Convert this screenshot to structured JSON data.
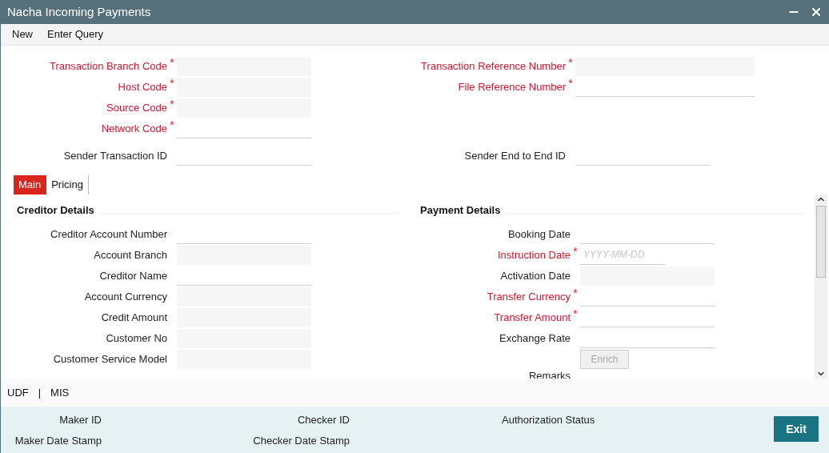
{
  "window": {
    "title": "Nacha Incoming Payments"
  },
  "menu": [
    "New",
    "Enter Query"
  ],
  "required_mark": "*",
  "header": {
    "left": [
      {
        "label": "Transaction Branch Code",
        "required": true,
        "disabled": true
      },
      {
        "label": "Host Code",
        "required": true,
        "disabled": true
      },
      {
        "label": "Source Code",
        "required": true,
        "disabled": true
      },
      {
        "label": "Network Code",
        "required": true,
        "disabled": false
      }
    ],
    "right": [
      {
        "label": "Transaction Reference Number",
        "required": true,
        "disabled": true
      },
      {
        "label": "File Reference Number",
        "required": true,
        "disabled": false
      }
    ],
    "sender_left": {
      "label": "Sender Transaction ID",
      "required": false,
      "disabled": false
    },
    "sender_right": {
      "label": "Sender End to End ID",
      "required": false,
      "disabled": false
    }
  },
  "tabs": [
    {
      "label": "Main",
      "selected": true
    },
    {
      "label": "Pricing",
      "selected": false
    }
  ],
  "creditor": {
    "title": "Creditor Details",
    "fields": [
      {
        "label": "Creditor Account Number",
        "required": false,
        "disabled": false
      },
      {
        "label": "Account Branch",
        "required": false,
        "disabled": true
      },
      {
        "label": "Creditor Name",
        "required": false,
        "disabled": false
      },
      {
        "label": "Account Currency",
        "required": false,
        "disabled": true
      },
      {
        "label": "Credit Amount",
        "required": false,
        "disabled": true
      },
      {
        "label": "Customer No",
        "required": false,
        "disabled": true
      },
      {
        "label": "Customer Service Model",
        "required": false,
        "disabled": true
      }
    ]
  },
  "payment": {
    "title": "Payment Details",
    "fields": [
      {
        "label": "Booking Date",
        "required": false,
        "disabled": false
      },
      {
        "label": "Instruction Date",
        "required": true,
        "disabled": false,
        "placeholder": "YYYY-MM-DD"
      },
      {
        "label": "Activation Date",
        "required": false,
        "disabled": true
      },
      {
        "label": "Transfer Currency",
        "required": true,
        "disabled": false
      },
      {
        "label": "Transfer Amount",
        "required": true,
        "disabled": false
      },
      {
        "label": "Exchange Rate",
        "required": false,
        "disabled": false
      }
    ],
    "enrich_button": {
      "label": "Enrich",
      "disabled": true
    },
    "remarks_label": "Remarks"
  },
  "links": [
    "UDF",
    "|",
    "MIS"
  ],
  "audit": [
    {
      "label": "Maker ID"
    },
    {
      "label": "Checker ID"
    },
    {
      "label": "Authorization Status"
    },
    {
      "label": "Maker Date Stamp"
    },
    {
      "label": "Checker Date Stamp"
    }
  ],
  "exit_button": "Exit"
}
